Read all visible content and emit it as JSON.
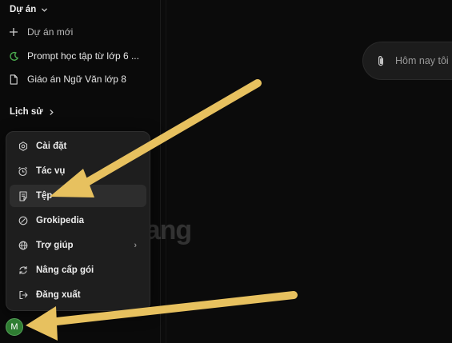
{
  "sidebar": {
    "projects_header": "Dự án",
    "new_project_label": "Dự án mới",
    "projects": [
      {
        "label": "Prompt học tập từ lớp 6 ...",
        "icon": "moon-icon"
      },
      {
        "label": "Giáo án Ngữ Văn lớp 8",
        "icon": "document-icon"
      }
    ],
    "history_header": "Lịch sử"
  },
  "account_menu": {
    "items": [
      {
        "label": "Cài đặt",
        "icon": "gear-icon"
      },
      {
        "label": "Tác vụ",
        "icon": "alarm-clock-icon"
      },
      {
        "label": "Tệp",
        "icon": "file-icon"
      },
      {
        "label": "Grokipedia",
        "icon": "grokipedia-icon"
      },
      {
        "label": "Trợ giúp",
        "icon": "globe-icon"
      },
      {
        "label": "Nâng cấp gói",
        "icon": "refresh-icon"
      },
      {
        "label": "Đăng xuất",
        "icon": "logout-icon"
      }
    ],
    "active_item": "Tệp"
  },
  "avatar": {
    "initial": "M",
    "color": "#2f7d32"
  },
  "composer": {
    "placeholder": "Hôm nay tôi"
  },
  "watermark": {
    "text": "uantrimang"
  },
  "colors": {
    "background": "#0b0b0b",
    "menu_bg": "#1e1e1e",
    "arrow": "#e7c15f",
    "moon": "#4caf50"
  }
}
